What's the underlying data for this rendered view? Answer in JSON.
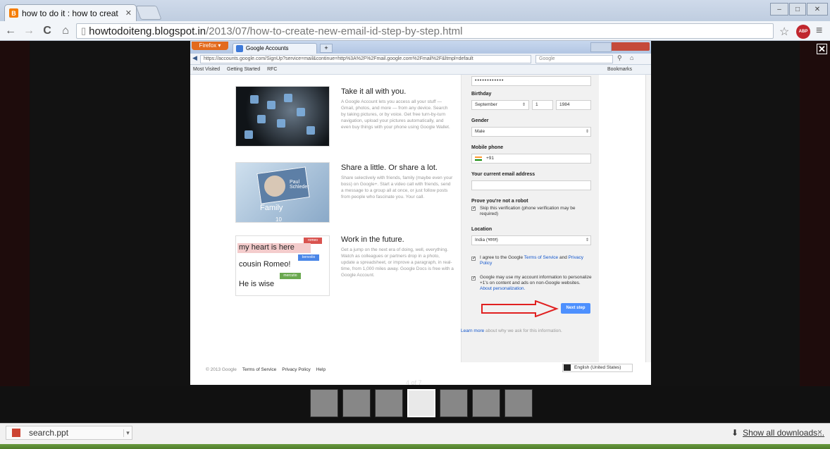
{
  "browser": {
    "tab_title": "how to do it : how to creat",
    "tab_icon": "B",
    "address_host": "howtodoiteng.blogspot.in",
    "address_path": "/2013/07/how-to-create-new-email-id-step-by-step.html",
    "abp_badge": "ABP"
  },
  "inner_window": {
    "firefox_label": "Firefox ▾",
    "tab_title": "Google Accounts",
    "url": "https://accounts.google.com/SignUp?service=mail&continue=http%3A%2F%2Fmail.google.com%2Fmail%2F&ltmpl=default",
    "search_placeholder": "Google",
    "bookmarks": [
      "Most Visited",
      "Getting Started",
      "RFC"
    ],
    "bookmarks_menu": "Bookmarks"
  },
  "promos": [
    {
      "heading": "Take it all with you.",
      "text": "A Google Account lets you access all your stuff — Gmail, photos, and more — from any device. Search by taking pictures, or by voice. Get free turn-by-turn navigation, upload your pictures automatically, and even buy things with your phone using Google Wallet."
    },
    {
      "heading": "Share a little. Or share a lot.",
      "text": "Share selectively with friends, family (maybe even your boss) on Google+. Start a video call with friends, send a message to a group all at once, or just follow posts from people who fascinate you. Your call."
    },
    {
      "heading": "Work in the future.",
      "text": "Get a jump on the next era of doing, well, everything. Watch as colleagues or partners drop in a photo, update a spreadsheet, or improve a paragraph, in real-time, from 1,000 miles away. Google Docs is free with a Google Account."
    }
  ],
  "promo_images": {
    "share_name": "Paul Schleder",
    "share_group": "Family",
    "share_count": "10",
    "doc_line1": "my heart is here",
    "doc_line2": "cousin Romeo!",
    "doc_line3": "He is wise",
    "tag1": "romeo",
    "tag2": "benvolio",
    "tag3": "mercutio"
  },
  "form": {
    "password_mask": "••••••••••••",
    "birthday_label": "Birthday",
    "birth_month": "September",
    "birth_day": "1",
    "birth_year": "1984",
    "gender_label": "Gender",
    "gender_value": "Male",
    "mobile_label": "Mobile phone",
    "mobile_code": "+91",
    "email_label": "Your current email address",
    "robot_label": "Prove you're not a robot",
    "robot_text": "Skip this verification (phone verification may be required)",
    "location_label": "Location",
    "location_value": "India (भारत)",
    "tos_text_a": "I agree to the Google ",
    "tos_link": "Terms of Service",
    "tos_text_b": " and ",
    "privacy_link": "Privacy Policy",
    "personalize_text": "Google may use my account information to personalize +1's on content and ads on non-Google websites.",
    "personalize_link": "About personalization.",
    "next_button": "Next step",
    "learn_more_link": "Learn more",
    "learn_more_text": " about why we ask for this information."
  },
  "footer": {
    "copyright": "© 2013 Google",
    "terms": "Terms of Service",
    "privacy": "Privacy Policy",
    "help": "Help",
    "language": "English (United States)"
  },
  "lightbox": {
    "counter": "4 of 7",
    "thumbnail_count": 7,
    "active_index": 3
  },
  "downloads": {
    "file": "search.ppt",
    "show_all": "Show all downloads...",
    "close": "×"
  },
  "colors": {
    "accent_blue": "#4d90fe",
    "arrow_red": "#e02020",
    "blogger_orange": "#f57d00"
  }
}
